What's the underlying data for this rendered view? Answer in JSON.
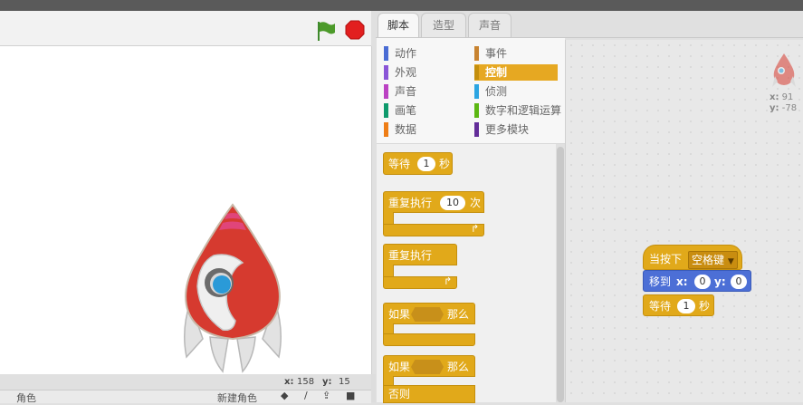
{
  "stage": {
    "coords": {
      "x_label": "x:",
      "x_value": "158",
      "y_label": "y:",
      "y_value": "15"
    },
    "sprite_bar": {
      "label": "角色",
      "new_sprite_label": "新建角色"
    }
  },
  "tabs": [
    {
      "label": "脚本",
      "active": true
    },
    {
      "label": "造型",
      "active": false
    },
    {
      "label": "声音",
      "active": false
    }
  ],
  "categories": [
    {
      "label": "动作",
      "color": "#4a6cd4"
    },
    {
      "label": "外观",
      "color": "#8a55d7"
    },
    {
      "label": "声音",
      "color": "#bb42c3"
    },
    {
      "label": "画笔",
      "color": "#0e9a6c"
    },
    {
      "label": "数据",
      "color": "#ee7d16"
    },
    {
      "label": "事件",
      "color": "#c88330"
    },
    {
      "label": "控制",
      "color": "#e1a91a",
      "selected": true
    },
    {
      "label": "侦测",
      "color": "#2ca5e2"
    },
    {
      "label": "数字和逻辑运算",
      "color": "#5cb712"
    },
    {
      "label": "更多模块",
      "color": "#632d99"
    }
  ],
  "palette": {
    "wait": {
      "label": "等待",
      "value": "1",
      "unit": "秒"
    },
    "repeat": {
      "label": "重复执行",
      "value": "10",
      "unit": "次"
    },
    "forever": {
      "label": "重复执行"
    },
    "if_then": {
      "label": "如果",
      "then": "那么"
    },
    "if_else": {
      "label": "如果",
      "then": "那么",
      "else": "否则"
    }
  },
  "script": {
    "hat": {
      "label": "当按下",
      "key": "空格键"
    },
    "goto": {
      "label": "移到",
      "x_label": "x:",
      "x_value": "0",
      "y_label": "y:",
      "y_value": "0"
    },
    "wait": {
      "label": "等待",
      "value": "1",
      "unit": "秒"
    }
  },
  "sprite_info": {
    "x_label": "x:",
    "x_value": "91",
    "y_label": "y:",
    "y_value": "-78"
  },
  "icons": [
    "green-flag-icon",
    "stop-icon",
    "rocket-sprite",
    "chevron-down-icon"
  ],
  "colors": {
    "control": "#e1a91a",
    "motion": "#4c6fd6",
    "stop": "#e21f1f",
    "flag": "#3f8a2c"
  }
}
